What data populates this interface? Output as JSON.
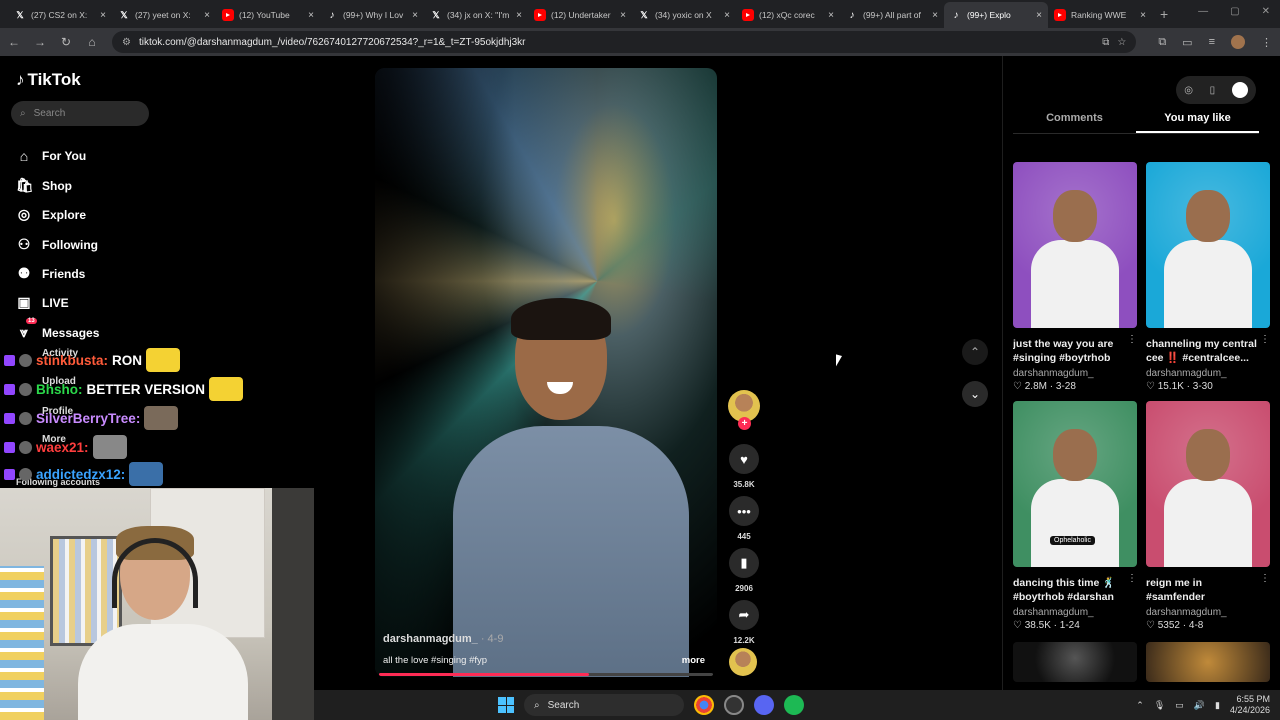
{
  "browser": {
    "tabs": [
      {
        "label": "(27) CS2 on X:",
        "icon": "x-icon",
        "active": false
      },
      {
        "label": "(27) yeet on X:",
        "icon": "x-icon",
        "active": false
      },
      {
        "label": "(12) YouTube",
        "icon": "youtube-icon",
        "active": false
      },
      {
        "label": "(99+) Why I Lov",
        "icon": "tiktok-icon",
        "active": false
      },
      {
        "label": "(34) jx on X: \"I'm",
        "icon": "x-icon",
        "active": false
      },
      {
        "label": "(12) Undertaker",
        "icon": "youtube-icon",
        "active": false
      },
      {
        "label": "(34) yoxic on X",
        "icon": "x-icon",
        "active": false
      },
      {
        "label": "(12) xQc corec",
        "icon": "youtube-icon",
        "active": false
      },
      {
        "label": "(99+) All part of",
        "icon": "tiktok-icon",
        "active": false
      },
      {
        "label": "(99+) Explo",
        "icon": "tiktok-icon",
        "active": true
      },
      {
        "label": "Ranking WWE",
        "icon": "youtube-icon",
        "active": false
      }
    ],
    "url": "tiktok.com/@darshanmagdum_/video/7626740127720672534?_r=1&_t=ZT-95okjdhj3kr"
  },
  "sidebar": {
    "logo": "TikTok",
    "search_placeholder": "Search",
    "nav": [
      {
        "label": "For You",
        "icon": "home-icon"
      },
      {
        "label": "Shop",
        "icon": "shopping-bag-icon"
      },
      {
        "label": "Explore",
        "icon": "compass-icon"
      },
      {
        "label": "Following",
        "icon": "following-icon"
      },
      {
        "label": "Friends",
        "icon": "friends-icon"
      },
      {
        "label": "LIVE",
        "icon": "live-icon"
      },
      {
        "label": "Messages",
        "icon": "messages-icon",
        "badge": "13"
      }
    ],
    "ghost_items": [
      "Activity",
      "Upload",
      "Profile",
      "More",
      "Following accounts"
    ]
  },
  "chat": [
    {
      "user": "stinkbusta:",
      "message": "RON",
      "color": "#ff5b3a"
    },
    {
      "user": "Bhsho:",
      "message": "BETTER VERSION",
      "color": "#2bd84a"
    },
    {
      "user": "SilverBerryTree:",
      "message": "",
      "color": "#c98bff"
    },
    {
      "user": "waex21:",
      "message": "",
      "color": "#ff3e3e"
    },
    {
      "user": "addictedzx12:",
      "message": "",
      "color": "#3aa3ff"
    }
  ],
  "video": {
    "author": "darshanmagdum_",
    "date": "4-9",
    "caption": "all the love #singing #fyp",
    "more": "more",
    "progress": 0.63,
    "actions": {
      "likes": "35.8K",
      "comments": "445",
      "saves": "2906",
      "shares": "12.2K"
    }
  },
  "right_panel": {
    "tabs": [
      "Comments",
      "You may like"
    ],
    "active_tab": "You may like",
    "cards": [
      {
        "title": "just the way you are #singing #boytrhob",
        "author": "darshanmagdum_",
        "stats": "♡ 2.8M · 3-28",
        "bg": "#8e4fbf",
        "tag": ""
      },
      {
        "title": "channeling my central cee ‼️ #centralcee...",
        "author": "darshanmagdum_",
        "stats": "♡ 15.1K · 3-30",
        "bg": "#1aa8d8",
        "tag": ""
      },
      {
        "title": "dancing this time 🕺 #boytrhob #darshan",
        "author": "darshanmagdum_",
        "stats": "♡ 38.5K · 1-24",
        "bg": "#3f8f62",
        "tag": "Ophelaholic"
      },
      {
        "title": "reign me in #samfender #oliviadean #singing",
        "author": "darshanmagdum_",
        "stats": "♡ 5352 · 4-8",
        "bg": "#c94d6f",
        "tag": ""
      }
    ]
  },
  "taskbar": {
    "search_placeholder": "Search",
    "time": "6:55 PM",
    "date": "4/24/2026"
  }
}
